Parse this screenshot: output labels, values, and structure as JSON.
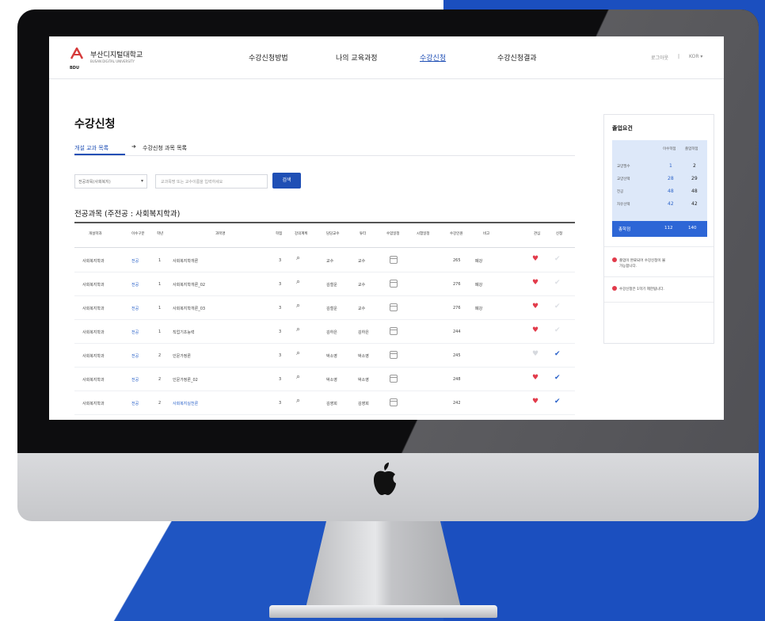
{
  "header": {
    "logo_mark": "ᆞ",
    "logo_mark_small": "BDU",
    "logo_name": "부산디지털대학교",
    "logo_sub": "BUSAN DIGITAL UNIVERSITY",
    "menu": [
      "수강신청방법",
      "나의 교육과정",
      "수강신청",
      "수강신청결과"
    ],
    "active_menu_index": 2,
    "util_left": "로그아웃",
    "util_sep": "|",
    "util_right": "KOR ▾"
  },
  "page": {
    "title": "수강신청",
    "breadcrumb_1": "개설 교과 목록",
    "breadcrumb_arrow": "➜",
    "breadcrumb_2": "수강신청 과목 목록"
  },
  "filters": {
    "select_value": "전공과목(사회복지)",
    "select_chevron": "▾",
    "search_placeholder": "교과목명 또는 교수이름을 입력하세요",
    "search_button": "검색"
  },
  "section_title": "전공과목 (주전공 : 사회복지학과)",
  "table": {
    "headers": [
      "개설학과",
      "이수구분",
      "학년",
      "과목명",
      "학점",
      "강의계획",
      "담당교수",
      "튜터",
      "수업일정",
      "시험일정",
      "수강인원",
      "비고",
      "관심",
      "신청"
    ],
    "rows": [
      {
        "dept": "사회복지학과",
        "type": "전공",
        "year": "1",
        "name": "사회복지학개론",
        "credit": "3",
        "prof": "교수",
        "tutor": "교수",
        "count": "265",
        "note": "폐강",
        "heart": true,
        "check": false,
        "name_blue": false
      },
      {
        "dept": "사회복지학과",
        "type": "전공",
        "year": "1",
        "name": "사회복지학개론_02",
        "credit": "3",
        "prof": "김철운",
        "tutor": "교수",
        "count": "276",
        "note": "폐강",
        "heart": true,
        "check": false,
        "name_blue": false
      },
      {
        "dept": "사회복지학과",
        "type": "전공",
        "year": "1",
        "name": "사회복지학개론_03",
        "credit": "3",
        "prof": "김철운",
        "tutor": "교수",
        "count": "276",
        "note": "폐강",
        "heart": true,
        "check": false,
        "name_blue": false
      },
      {
        "dept": "사회복지학과",
        "type": "전공",
        "year": "1",
        "name": "직업기초능력",
        "credit": "3",
        "prof": "김하은",
        "tutor": "김하은",
        "count": "244",
        "note": "",
        "heart": true,
        "check": false,
        "name_blue": false
      },
      {
        "dept": "사회복지학과",
        "type": "전공",
        "year": "2",
        "name": "인문가정론",
        "credit": "3",
        "prof": "박소영",
        "tutor": "박소영",
        "count": "245",
        "note": "",
        "heart": false,
        "check": true,
        "name_blue": false
      },
      {
        "dept": "사회복지학과",
        "type": "전공",
        "year": "2",
        "name": "인문가정론_02",
        "credit": "3",
        "prof": "박소영",
        "tutor": "박소영",
        "count": "248",
        "note": "",
        "heart": true,
        "check": true,
        "name_blue": false
      },
      {
        "dept": "사회복지학과",
        "type": "전공",
        "year": "2",
        "name": "사회복지실천론",
        "credit": "3",
        "prof": "김영희",
        "tutor": "김영희",
        "count": "242",
        "note": "",
        "heart": true,
        "check": true,
        "name_blue": true
      }
    ]
  },
  "sidebar": {
    "title": "졸업요건",
    "col_1": "이수학점",
    "col_2": "졸업학점",
    "rows": [
      {
        "label": "교양필수",
        "v1": "1",
        "v2": "2"
      },
      {
        "label": "교양선택",
        "v1": "28",
        "v2": "29"
      },
      {
        "label": "전공",
        "v1": "48",
        "v2": "48"
      },
      {
        "label": "자유선택",
        "v1": "42",
        "v2": "42"
      }
    ],
    "total_label": "총학점",
    "total_1": "112",
    "total_2": "140",
    "notice_1a": "졸업이 완료되어 수강신청이 불",
    "notice_1b": "가능합니다.",
    "notice_2": "수강신청은 1학기 제한됩니다."
  },
  "device": {
    "apple_icon": ""
  },
  "colors": {
    "accent": "#1f4fb5",
    "background_blue": "#1f55c2",
    "heart": "#e23b4b"
  }
}
